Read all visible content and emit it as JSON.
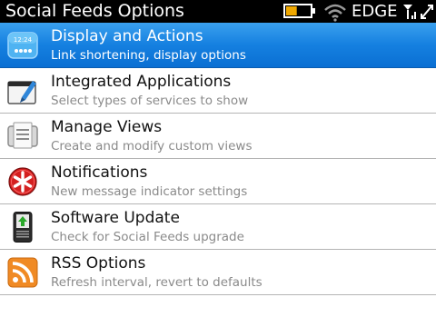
{
  "statusbar": {
    "title": "Social Feeds Options",
    "network": "EDGE",
    "battery_level": 0.45,
    "icons": [
      "battery-icon",
      "wifi-icon",
      "signal-bars-icon",
      "data-transfer-icon"
    ]
  },
  "colors": {
    "selection": "#1580e0",
    "battery_fill": "#f0a800",
    "rss": "#f08a24",
    "notification": "#d42020",
    "update_arrow": "#2aa82a"
  },
  "menu": {
    "items": [
      {
        "label": "Display and Actions",
        "description": "Link shortening, display options",
        "icon": "display-actions-icon",
        "icon_text": "12:24",
        "selected": true
      },
      {
        "label": "Integrated Applications",
        "description": "Select types of services to show",
        "icon": "integrated-apps-icon",
        "selected": false
      },
      {
        "label": "Manage Views",
        "description": "Create and modify custom views",
        "icon": "manage-views-icon",
        "selected": false
      },
      {
        "label": "Notifications",
        "description": "New message indicator settings",
        "icon": "notifications-icon",
        "selected": false
      },
      {
        "label": "Software Update",
        "description": "Check for Social Feeds upgrade",
        "icon": "software-update-icon",
        "selected": false
      },
      {
        "label": "RSS Options",
        "description": "Refresh interval, revert to defaults",
        "icon": "rss-icon",
        "selected": false
      }
    ]
  }
}
